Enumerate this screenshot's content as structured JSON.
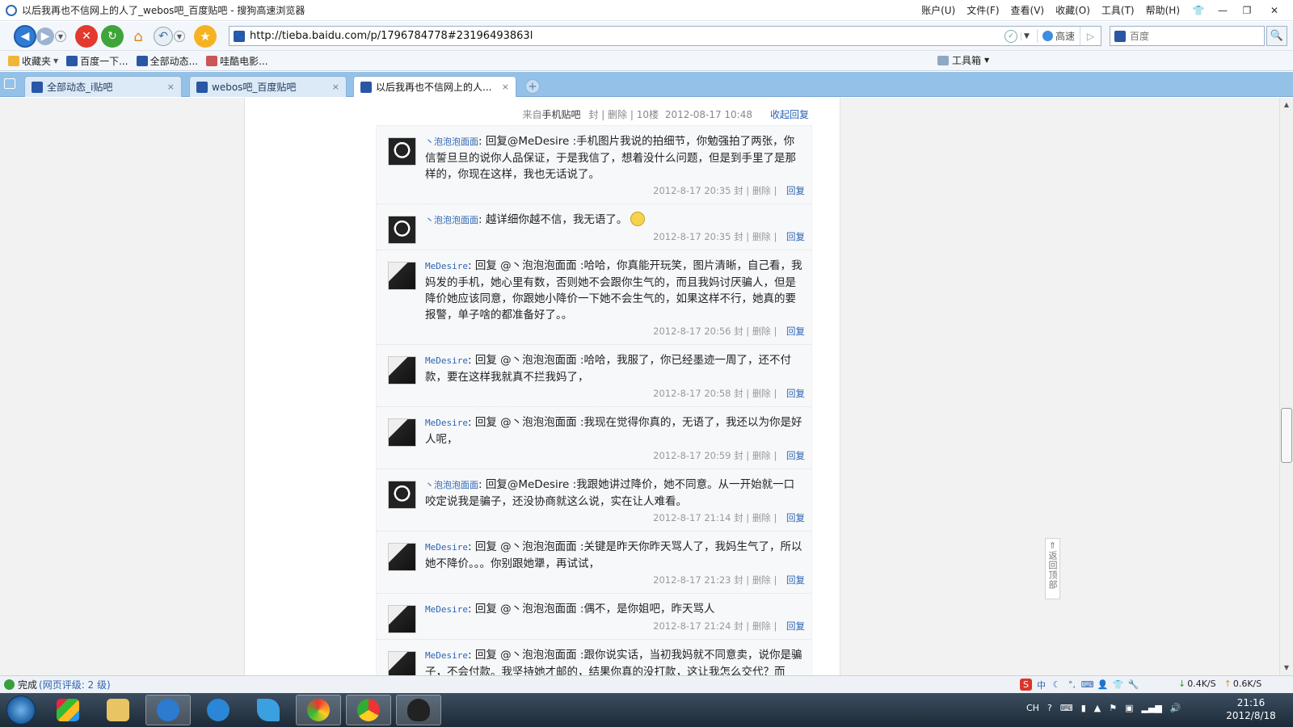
{
  "window": {
    "title": "以后我再也不信网上的人了_webos吧_百度贴吧 - 搜狗高速浏览器",
    "menus": [
      "账户(U)",
      "文件(F)",
      "查看(V)",
      "收藏(O)",
      "工具(T)",
      "帮助(H)"
    ]
  },
  "toolbar": {
    "url": "http://tieba.baidu.com/p/1796784778#23196493863l",
    "speed_label": "高速",
    "search_placeholder": "百度"
  },
  "bookmarks": {
    "items": [
      {
        "label": "收藏夹",
        "icon": "favorites-icon"
      },
      {
        "label": "百度一下...",
        "icon": "baidu-paw-icon"
      },
      {
        "label": "全部动态...",
        "icon": "baidu-paw-icon"
      },
      {
        "label": "哇酷电影...",
        "icon": "film-icon"
      }
    ],
    "toolbox_label": "工具箱"
  },
  "tabs": [
    {
      "label": "全部动态_i贴吧",
      "active": false
    },
    {
      "label": "webos吧_百度贴吧",
      "active": false
    },
    {
      "label": "以后我再也不信网上的人...",
      "active": true
    }
  ],
  "post": {
    "source_prefix": "来自",
    "source": "手机贴吧",
    "ban": "封",
    "delete": "删除",
    "floor": "10楼",
    "datetime": "2012-08-17 10:48",
    "collapse_label": "收起回复"
  },
  "replies": [
    {
      "user": "丶泡泡泡面面",
      "avatar": "bubble",
      "content": "回复@MeDesire :手机图片我说的拍细节，你勉强拍了两张，你信誓旦旦的说你人品保证，于是我信了，想着没什么问题，但是到手里了是那样的，你现在这样，我也无话说了。",
      "time": "2012-8-17 20:35",
      "emoji": false
    },
    {
      "user": "丶泡泡泡面面",
      "avatar": "bubble",
      "content": "越详细你越不信，我无语了。",
      "time": "2012-8-17 20:35",
      "emoji": true
    },
    {
      "user": "MeDesire",
      "avatar": "desire",
      "content": "回复 @丶泡泡泡面面 :哈哈，你真能开玩笑，图片清晰，自己看，我妈发的手机，她心里有数，否则她不会跟你生气的，而且我妈讨厌骗人，但是降价她应该同意，你跟她小降价一下她不会生气的，如果这样不行，她真的要报警，单子啥的都准备好了。。",
      "time": "2012-8-17 20:56",
      "emoji": false
    },
    {
      "user": "MeDesire",
      "avatar": "desire",
      "content": "回复 @丶泡泡泡面面 :哈哈，我服了，你已经墨迹一周了，还不付款，要在这样我就真不拦我妈了，",
      "time": "2012-8-17 20:58",
      "emoji": false
    },
    {
      "user": "MeDesire",
      "avatar": "desire",
      "content": "回复 @丶泡泡泡面面 :我现在觉得你真的，无语了，我还以为你是好人呢，",
      "time": "2012-8-17 20:59",
      "emoji": false
    },
    {
      "user": "丶泡泡泡面面",
      "avatar": "bubble",
      "content": "回复@MeDesire :我跟她讲过降价，她不同意。从一开始就一口咬定说我是骗子，还没协商就这么说，实在让人难看。",
      "time": "2012-8-17 21:14",
      "emoji": false
    },
    {
      "user": "MeDesire",
      "avatar": "desire",
      "content": "回复 @丶泡泡泡面面 :关键是昨天你昨天骂人了，我妈生气了，所以她不降价。。。你别跟她犟，再试试，",
      "time": "2012-8-17 21:23",
      "emoji": false
    },
    {
      "user": "MeDesire",
      "avatar": "desire",
      "content": "回复 @丶泡泡泡面面 :偶不，是你姐吧，昨天骂人",
      "time": "2012-8-17 21:24",
      "emoji": false
    },
    {
      "user": "MeDesire",
      "avatar": "desire",
      "content": "回复 @丶泡泡泡面面 :跟你说实话，当初我妈就不同意卖，说你是骗子，不会付款。我坚持她才邮的，结果你真的没打款，这让我怎么交代？而",
      "time": "",
      "emoji": false
    }
  ],
  "reply_actions": {
    "ban": "封",
    "delete": "删除",
    "reply": "回复"
  },
  "back_to_top": "返回顶部",
  "statusbar": {
    "status": "完成",
    "rating": "(网页评级: 2 级)",
    "download_speed": "0.4K/S",
    "upload_speed": "0.6K/S"
  },
  "taskbar": {
    "time": "21:16",
    "date": "2012/8/18",
    "lang": "CH"
  }
}
